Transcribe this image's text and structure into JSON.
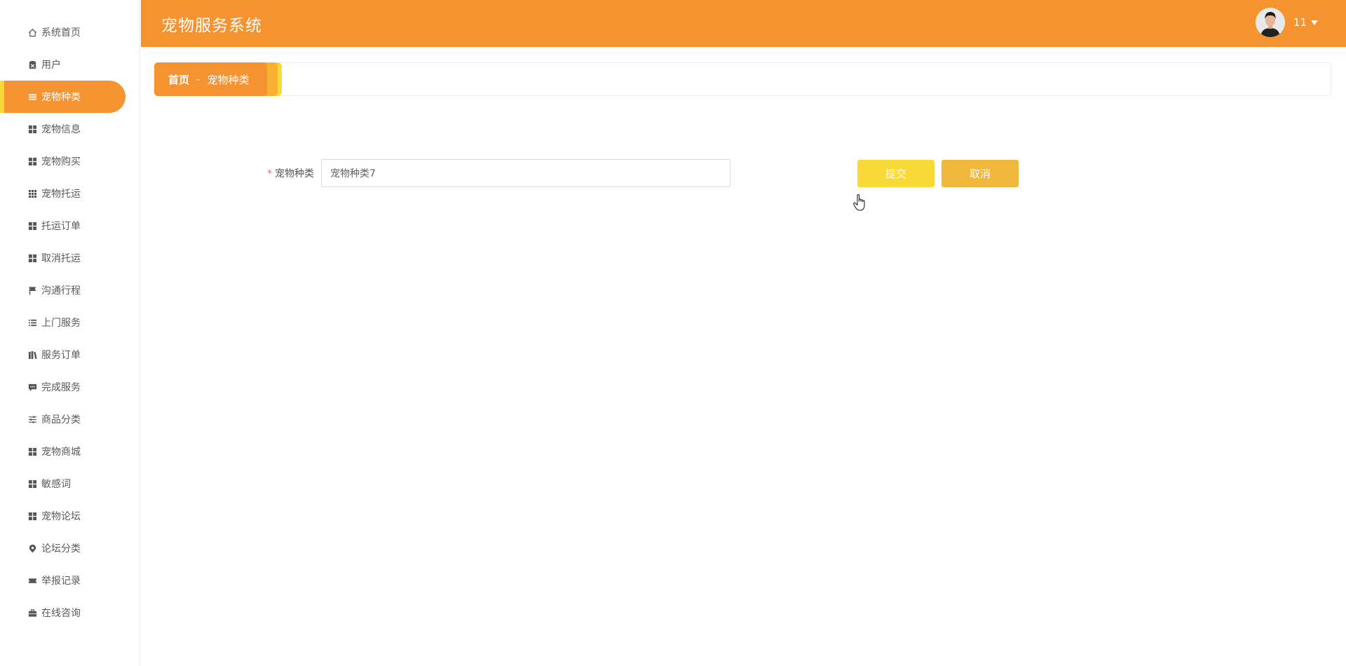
{
  "header": {
    "title": "宠物服务系统",
    "username": "11"
  },
  "sidebar": {
    "items": [
      {
        "label": "系统首页",
        "icon": "home-icon"
      },
      {
        "label": "用户",
        "icon": "clipboard-icon"
      },
      {
        "label": "宠物种类",
        "icon": "list-icon",
        "active": true
      },
      {
        "label": "宠物信息",
        "icon": "grid-icon"
      },
      {
        "label": "宠物购买",
        "icon": "grid-icon"
      },
      {
        "label": "宠物托运",
        "icon": "apps-icon"
      },
      {
        "label": "托运订单",
        "icon": "grid-icon"
      },
      {
        "label": "取消托运",
        "icon": "grid-icon"
      },
      {
        "label": "沟通行程",
        "icon": "flag-icon"
      },
      {
        "label": "上门服务",
        "icon": "list-lines-icon"
      },
      {
        "label": "服务订单",
        "icon": "books-icon"
      },
      {
        "label": "完成服务",
        "icon": "comment-icon"
      },
      {
        "label": "商品分类",
        "icon": "sliders-icon"
      },
      {
        "label": "宠物商城",
        "icon": "grid-icon"
      },
      {
        "label": "敏感词",
        "icon": "grid-icon"
      },
      {
        "label": "宠物论坛",
        "icon": "grid-icon"
      },
      {
        "label": "论坛分类",
        "icon": "pin-icon"
      },
      {
        "label": "举报记录",
        "icon": "ticket-icon"
      },
      {
        "label": "在线咨询",
        "icon": "briefcase-icon"
      }
    ]
  },
  "breadcrumb": {
    "home": "首页",
    "separator": "-",
    "current": "宠物种类"
  },
  "form": {
    "label": "宠物种类",
    "required_mark": "*",
    "value": "宠物种类7"
  },
  "buttons": {
    "submit": "提交",
    "cancel": "取消"
  },
  "colors": {
    "primary": "#f59330",
    "accent_yellow": "#f9d937",
    "cancel": "#efb83a"
  }
}
